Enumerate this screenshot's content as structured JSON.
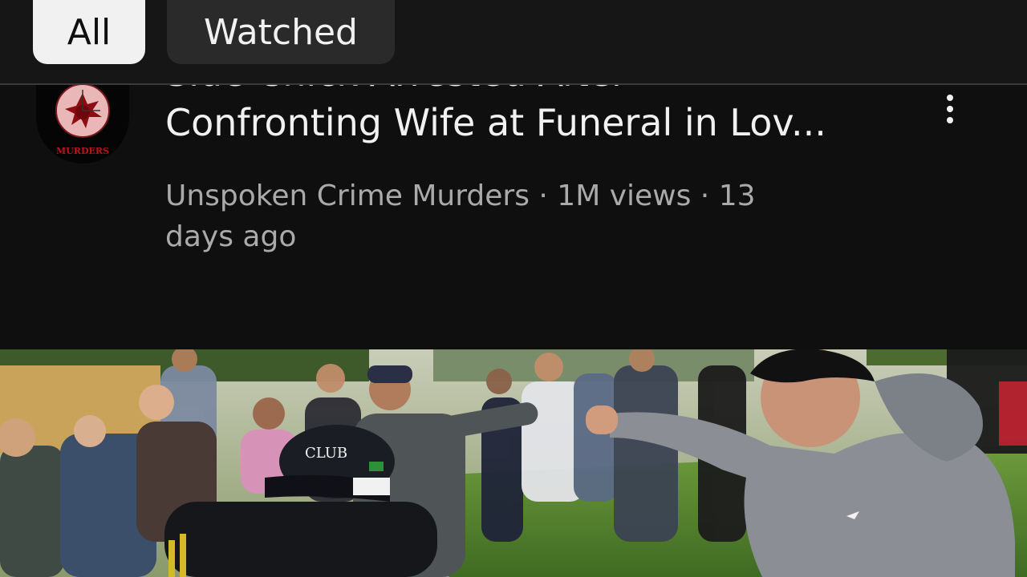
{
  "filter_chips": [
    {
      "label": "All",
      "active": true
    },
    {
      "label": "Watched",
      "active": false
    }
  ],
  "video": {
    "title_line1": "Side Chick Arrested After",
    "title_line2": "Confronting Wife at Funeral in Lov...",
    "channel": "Unspoken Crime Murders",
    "views": "1M views",
    "age": "13 days ago",
    "meta_line1": "Unspoken Crime Murders · 1M views · 13",
    "meta_line2": "days ago",
    "channel_avatar_text": "MURDERS",
    "menu_icon": "more-vert-icon"
  },
  "colors": {
    "background": "#0f0f0f",
    "chip_active_bg": "#f1f1f1",
    "chip_inactive_bg": "#2a2a2a",
    "meta_text": "#aaaaaa",
    "avatar_red": "#c0121c"
  }
}
